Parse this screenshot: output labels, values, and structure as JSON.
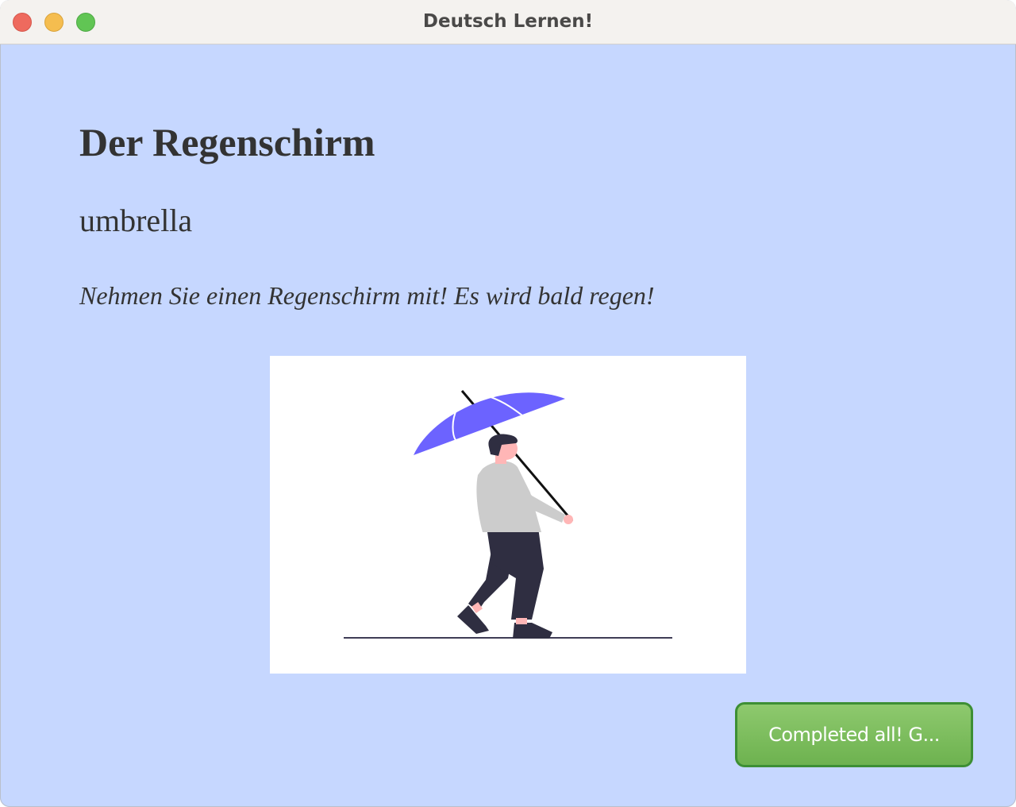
{
  "window": {
    "title": "Deutsch Lernen!"
  },
  "card": {
    "german_word": "Der Regenschirm",
    "translation": "umbrella",
    "example_sentence": "Nehmen Sie einen Regenschirm mit! Es wird bald regen!",
    "illustration_icon": "person-with-umbrella-illustration"
  },
  "actions": {
    "complete_label": "Completed all! G..."
  },
  "colors": {
    "background": "#c6d7ff",
    "umbrella": "#6c63ff",
    "button": "#7abd5a",
    "button_border": "#3d8f34"
  }
}
